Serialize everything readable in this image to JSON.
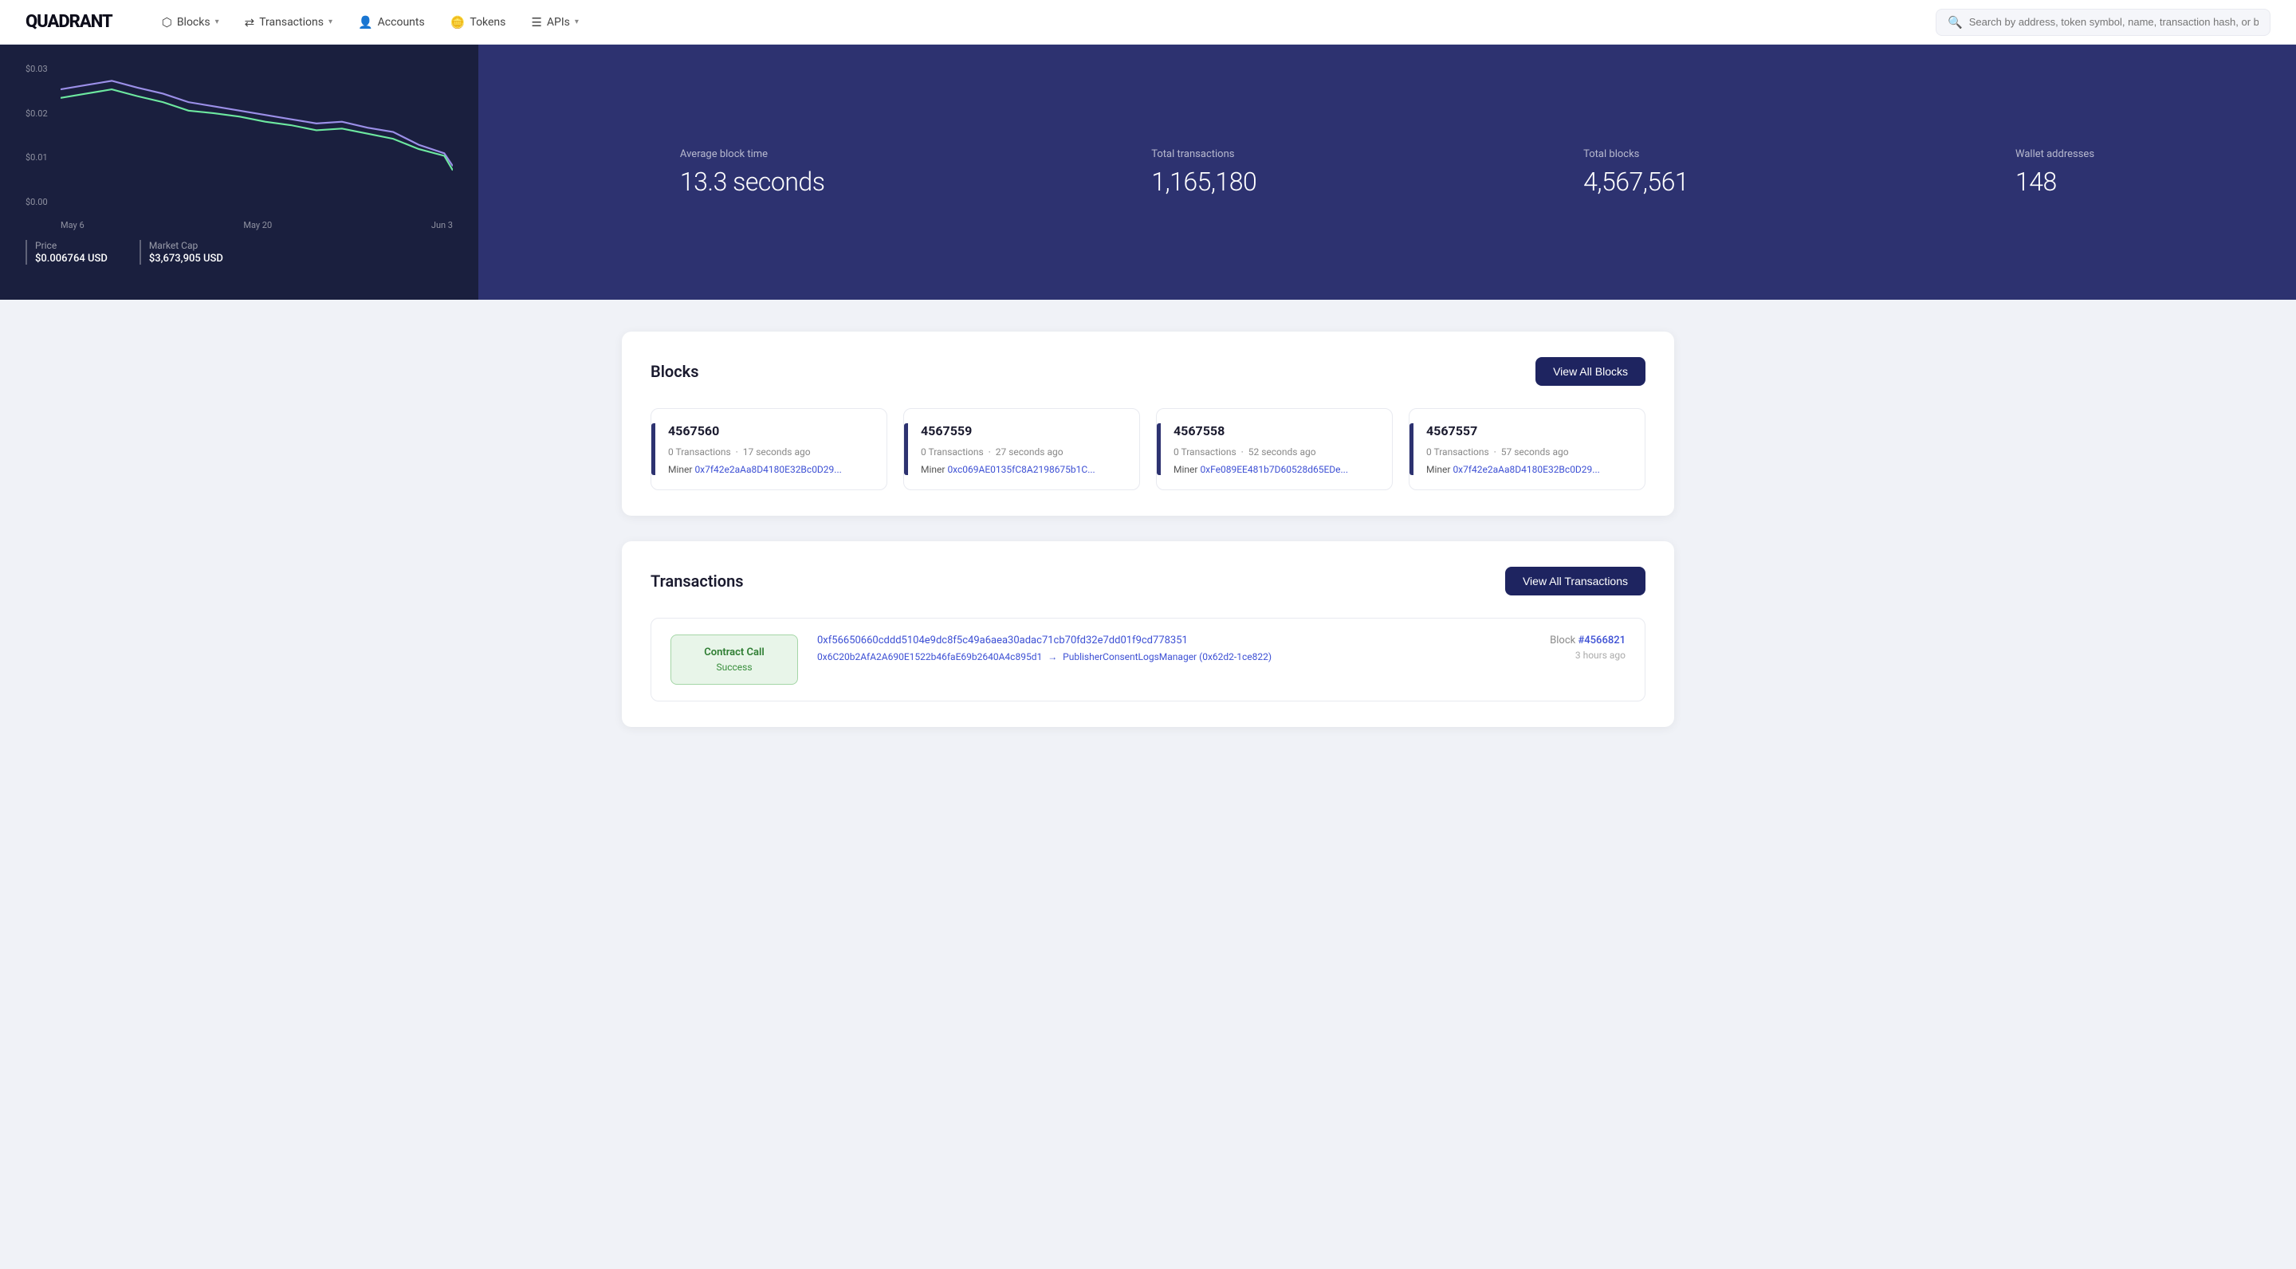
{
  "brand": {
    "logo": "QUADRANT"
  },
  "nav": {
    "items": [
      {
        "id": "blocks",
        "label": "Blocks",
        "icon": "⬡",
        "hasDropdown": true
      },
      {
        "id": "transactions",
        "label": "Transactions",
        "icon": "⇄",
        "hasDropdown": true
      },
      {
        "id": "accounts",
        "label": "Accounts",
        "icon": "👤",
        "hasDropdown": false
      },
      {
        "id": "tokens",
        "label": "Tokens",
        "icon": "🪙",
        "hasDropdown": false
      },
      {
        "id": "apis",
        "label": "APIs",
        "icon": "☰",
        "hasDropdown": true
      }
    ],
    "search": {
      "placeholder": "Search by address, token symbol, name, transaction hash, or block number"
    }
  },
  "hero": {
    "chart": {
      "y_labels": [
        "$0.03",
        "$0.02",
        "$0.01",
        "$0.00"
      ],
      "x_labels": [
        "May 6",
        "May 20",
        "Jun 3"
      ]
    },
    "price": {
      "label": "Price",
      "value": "$0.006764 USD"
    },
    "market_cap": {
      "label": "Market Cap",
      "value": "$3,673,905 USD"
    },
    "stats": [
      {
        "id": "avg_block_time",
        "label": "Average block time",
        "value": "13.3 seconds"
      },
      {
        "id": "total_transactions",
        "label": "Total transactions",
        "value": "1,165,180"
      },
      {
        "id": "total_blocks",
        "label": "Total blocks",
        "value": "4,567,561"
      },
      {
        "id": "wallet_addresses",
        "label": "Wallet addresses",
        "value": "148"
      }
    ]
  },
  "blocks_section": {
    "title": "Blocks",
    "view_all_label": "View All Blocks",
    "blocks": [
      {
        "number": "4567560",
        "transactions": "0 Transactions",
        "time": "17 seconds ago",
        "miner_label": "Miner",
        "miner_address": "0x7f42e2aAa8D4180E32Bc0D29..."
      },
      {
        "number": "4567559",
        "transactions": "0 Transactions",
        "time": "27 seconds ago",
        "miner_label": "Miner",
        "miner_address": "0xc069AE0135fC8A2198675b1C..."
      },
      {
        "number": "4567558",
        "transactions": "0 Transactions",
        "time": "52 seconds ago",
        "miner_label": "Miner",
        "miner_address": "0xFe089EE481b7D60528d65EDe..."
      },
      {
        "number": "4567557",
        "transactions": "0 Transactions",
        "time": "57 seconds ago",
        "miner_label": "Miner",
        "miner_address": "0x7f42e2aAa8D4180E32Bc0D29..."
      }
    ]
  },
  "transactions_section": {
    "title": "Transactions",
    "view_all_label": "View All Transactions",
    "transactions": [
      {
        "badge_label": "Contract Call",
        "badge_status": "Success",
        "hash": "0xf56650660cddd5104e9dc8f5c49a6aea30adac71cb70fd32e7dd01f9cd778351",
        "from": "0x6C20b2AfA2A690E1522b46faE69b2640A4c895d1",
        "arrow": "→",
        "to": "PublisherConsentLogsManager (0x62d2-1ce822)",
        "block_label": "Block",
        "block_ref": "#4566821",
        "time": "3 hours ago"
      }
    ]
  }
}
